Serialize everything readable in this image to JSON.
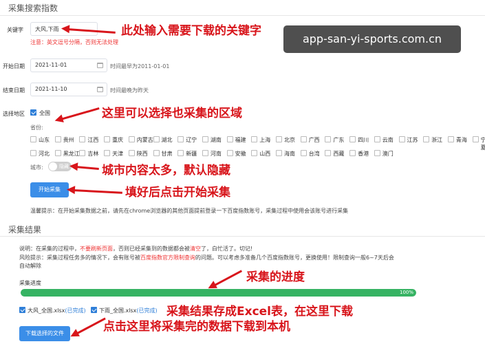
{
  "sections": {
    "search": "采集搜索指数",
    "result": "采集结果"
  },
  "keyword": {
    "label": "关键字",
    "value": "大风,下雨",
    "note": "注意：英文逗号分隔，否则无法处理"
  },
  "start_date": {
    "label": "开始日期",
    "value": "2021-11-01",
    "hint": "时间最早为2011-01-01"
  },
  "end_date": {
    "label": "结束日期",
    "value": "2021-11-10",
    "hint": "时间最晚为昨天"
  },
  "region": {
    "label": "选择地区",
    "all_label": "全国",
    "all_checked": true,
    "province_label": "省份:",
    "row1": [
      "山东",
      "贵州",
      "江西",
      "重庆",
      "内蒙古",
      "湖北",
      "辽宁",
      "湖南",
      "福建",
      "上海",
      "北京",
      "广西",
      "广东",
      "四川",
      "云南",
      "江苏",
      "浙江",
      "青海",
      "宁夏"
    ],
    "row2": [
      "河北",
      "黑龙江",
      "吉林",
      "天津",
      "陕西",
      "甘肃",
      "新疆",
      "河南",
      "安徽",
      "山西",
      "海南",
      "台湾",
      "西藏",
      "香港",
      "澳门"
    ],
    "city_label": "城市:",
    "city_toggle_text": "隐藏"
  },
  "start_button": "开始采集",
  "tip": "温馨提示：在开始采集数据之前，请先在chrome浏览器的其他页面提前登录一下百度指数账号，采集过程中使用会该账号进行采集",
  "result": {
    "explain_prefix": "说明：在采集的过程中，",
    "explain_red1": "不要刷新页面",
    "explain_mid": "，否则已经采集到的数据都会被",
    "explain_red2": "清空",
    "explain_suffix": "了，白忙活了。切记!",
    "risk_prefix": "风险提示：采集过程任务多的情况下，会有账号被",
    "risk_red": "百度指数官方限制查询",
    "risk_suffix": "的问题。可以考虑多准备几个百度指数账号，更换使用！限制查询一般6~7天后会",
    "risk_line2": "自动解除",
    "progress_label": "采集进度",
    "progress_value": 100,
    "progress_text": "100%",
    "files": [
      {
        "name": "大风_全国.xlsx",
        "status": "(已完成)",
        "checked": true
      },
      {
        "name": "下雨_全国.xlsx",
        "status": "(已完成)",
        "checked": true
      }
    ],
    "download_button": "下载选择的文件"
  },
  "annotations": {
    "keyword": "此处输入需要下载的关键字",
    "region": "这里可以选择也采集的区域",
    "city": "城市内容太多，默认隐藏",
    "start": "填好后点击开始采集",
    "progress": "采集的进度",
    "excel": "采集结果存成Excel表，在这里下载",
    "download": "点击这里将采集完的数据下载到本机"
  },
  "watermark": "app-san-yi-sports.com.cn",
  "colors": {
    "accent": "#3b8ee8",
    "annotation": "#d8151b",
    "progress": "#36b363",
    "warning": "#e33333"
  }
}
